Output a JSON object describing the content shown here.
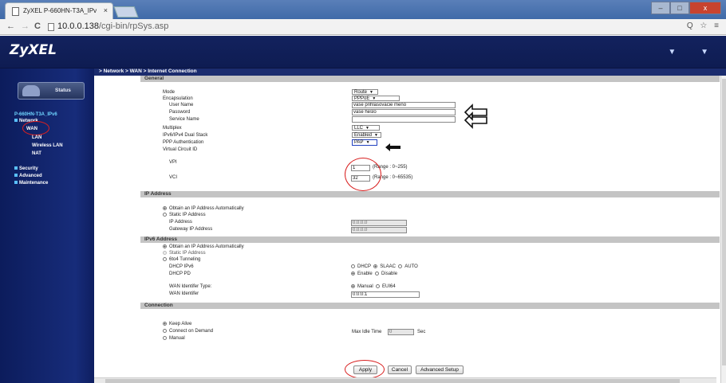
{
  "browser": {
    "tab_title": "ZyXEL P-660HN-T3A_IPv",
    "tab_close": "×",
    "url_host": "10.0.0.138",
    "url_path": "/cgi-bin/rpSys.asp",
    "back": "←",
    "forward": "→",
    "reload": "C",
    "toolbar_icons": "Q ☆ ≡",
    "window_controls": [
      "–",
      "□",
      "x"
    ]
  },
  "router": {
    "logo": "ZyXEL",
    "header_icons": "▼ ▼",
    "breadcrumb": "> Network > WAN > Internet Connection"
  },
  "sidebar": {
    "status": "Status",
    "device": "P-660HN-T3A_IPv6",
    "network": "Network",
    "wan": "WAN",
    "lan": "LAN",
    "wireless_lan": "Wireless LAN",
    "nat": "NAT",
    "security": "Security",
    "advanced": "Advanced",
    "maintenance": "Maintenance"
  },
  "general": {
    "title": "General",
    "mode_label": "Mode",
    "mode_value": "Route",
    "encapsulation_label": "Encapsulation",
    "encapsulation_value": "PPPoE",
    "username_label": "User Name",
    "username_value": "vase prihlasovacie meno",
    "password_label": "Password",
    "password_value": "vase heslo",
    "service_label": "Service Name",
    "service_value": "",
    "multiplex_label": "Multiplex",
    "multiplex_value": "LLC",
    "dualstack_label": "IPv6/IPv4 Dual Stack",
    "dualstack_value": "Enabled",
    "pppauth_label": "PPP Authentication",
    "pppauth_value": "PAP",
    "vc_label": "Virtual Circuit ID",
    "vpi_label": "VPI",
    "vpi_value": "1",
    "vpi_range": "(Range : 0~255)",
    "vci_label": "VCI",
    "vci_value": "32",
    "vci_range": "(Range : 0~65535)"
  },
  "ip_address": {
    "title": "IP Address",
    "obtain": "Obtain an IP Address Automatically",
    "static": "Static IP Address",
    "ip_label": "IP Address",
    "ip_value": "0.0.0.0",
    "gw_label": "Gateway IP Address",
    "gw_value": "0.0.0.0"
  },
  "ipv6": {
    "title": "IPv6 Address",
    "obtain": "Obtain an IP Address Automatically",
    "static": "Static IP Address",
    "tunnel": "6to4 Tunneling",
    "dhcp_label": "DHCP IPv6",
    "dhcp_opt1": "DHCP",
    "dhcp_opt2": "SLAAC",
    "dhcp_opt3": "AUTO",
    "pd_label": "DHCP PD",
    "pd_opt1": "Enable",
    "pd_opt2": "Disable",
    "wanid_type_label": "WAN Identifer Type:",
    "wanid_opt1": "Manual",
    "wanid_opt2": "EUI64",
    "wanid_label": "WAN Identifer",
    "wanid_value": "0:0:0:1"
  },
  "connection": {
    "title": "Connection",
    "keepalive": "Keep Alive",
    "ondemand": "Connect on Demand",
    "manual": "Manual",
    "maxidle_label": "Max Idle Time",
    "maxidle_value": "0",
    "maxidle_unit": "Sec"
  },
  "buttons": {
    "apply": "Apply",
    "cancel": "Cancel",
    "advanced": "Advanced Setup"
  },
  "colors": {
    "header": "#13225e",
    "sidebar": "#172c7a",
    "annotation_red": "#d82020",
    "section_bg": "#c4c4c4"
  }
}
